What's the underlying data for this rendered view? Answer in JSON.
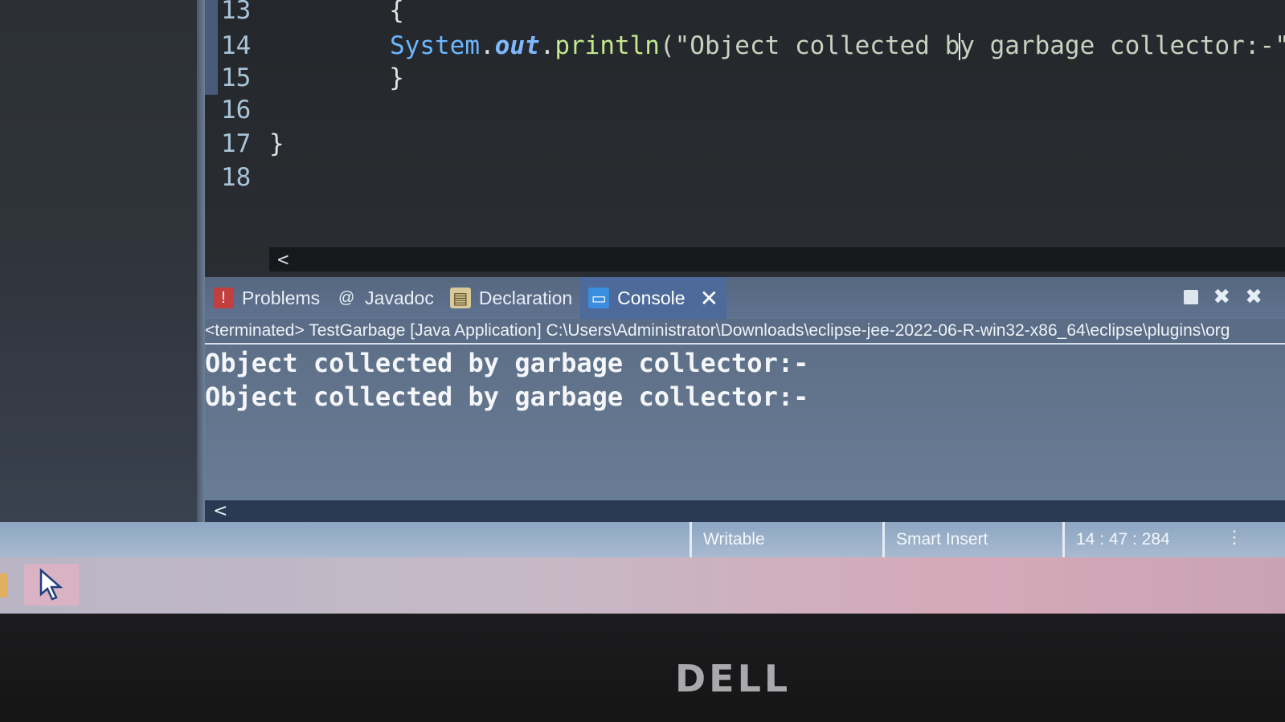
{
  "editor": {
    "lines": [
      {
        "num": "13",
        "text": "        {"
      },
      {
        "num": "14",
        "type": "System",
        "field": "out",
        "method": "println",
        "string_before_caret": "(\"Object collected b",
        "string_after_caret": "y garbage collector:-\")"
      },
      {
        "num": "15",
        "text": "        }"
      },
      {
        "num": "16",
        "text": ""
      },
      {
        "num": "17",
        "text": "}"
      },
      {
        "num": "18",
        "text": ""
      }
    ],
    "scroll_left_glyph": "<"
  },
  "panel": {
    "tabs": [
      {
        "label": "Problems",
        "icon": "problems-icon"
      },
      {
        "label": "Javadoc",
        "icon": "at-icon"
      },
      {
        "label": "Declaration",
        "icon": "declaration-icon"
      },
      {
        "label": "Console",
        "icon": "console-icon",
        "active": true
      }
    ],
    "close_glyph": "✕",
    "launch_info": "<terminated> TestGarbage [Java Application] C:\\Users\\Administrator\\Downloads\\eclipse-jee-2022-06-R-win32-x86_64\\eclipse\\plugins\\org",
    "console_output": [
      "Object collected by garbage collector:-",
      "Object collected by garbage collector:-"
    ],
    "scroll_left_glyph": "<"
  },
  "statusbar": {
    "writable": "Writable",
    "insert_mode": "Smart Insert",
    "position": "14 : 47 : 284",
    "menu_glyph": "⋮"
  },
  "bezel": {
    "logo": "DELL"
  },
  "colors": {
    "editor_bg": "#24272b",
    "panel_bg": "#5d6f89",
    "active_tab": "#4d6a9a",
    "keyword_type": "#6cb7ff",
    "method": "#c3e88d"
  }
}
